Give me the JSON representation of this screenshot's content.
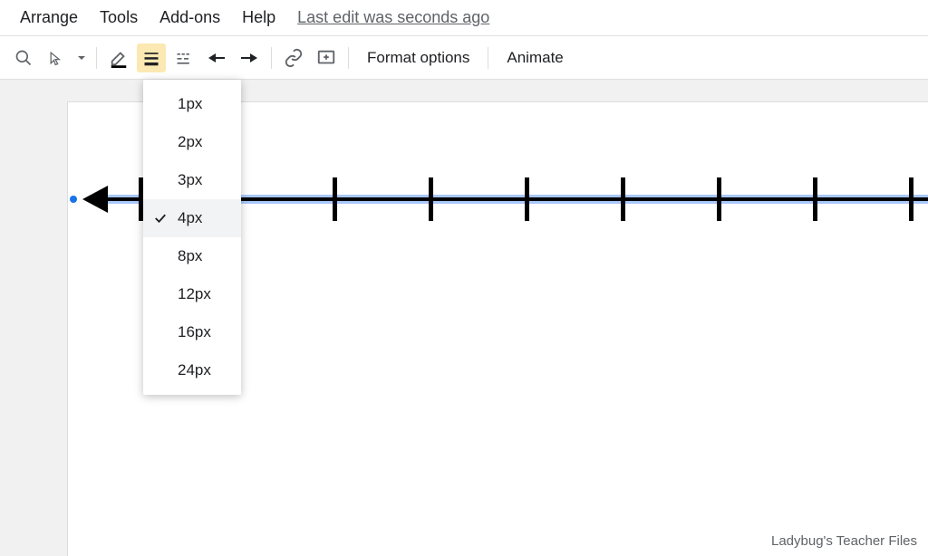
{
  "menu": {
    "arrange": "Arrange",
    "tools": "Tools",
    "addons": "Add-ons",
    "help": "Help",
    "edit_status": "Last edit was seconds ago"
  },
  "toolbar": {
    "format_options": "Format options",
    "animate": "Animate"
  },
  "line_weight_dropdown": {
    "options": [
      "1px",
      "2px",
      "3px",
      "4px",
      "8px",
      "12px",
      "16px",
      "24px"
    ],
    "selected": "4px"
  },
  "watermark": "Ladybug's Teacher Files"
}
